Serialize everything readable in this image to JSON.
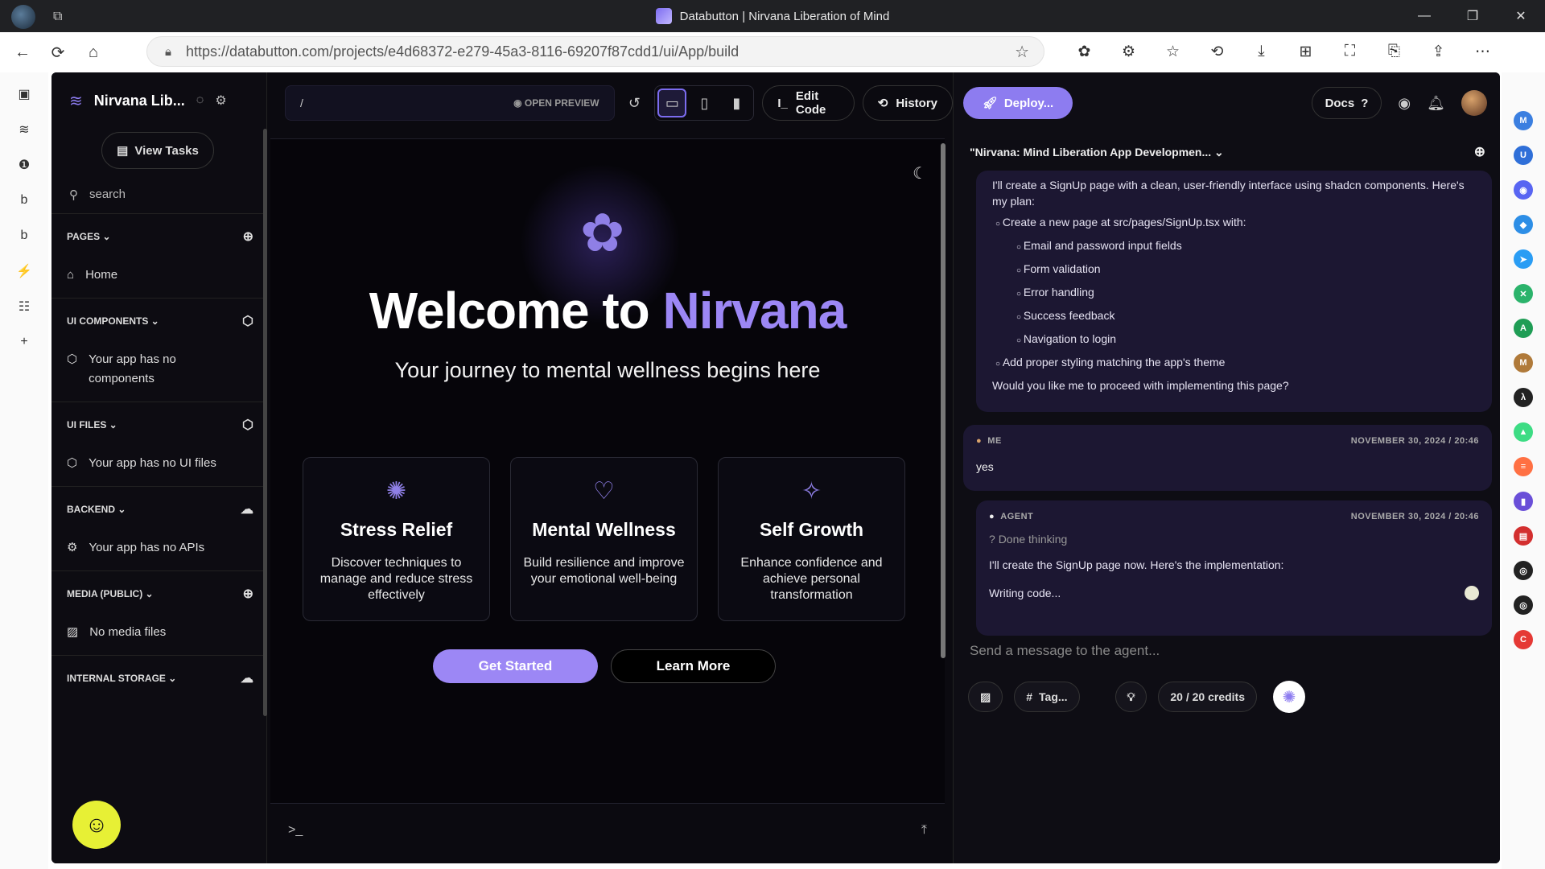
{
  "window": {
    "title": "Databutton | Nirvana Liberation of Mind",
    "min": "—",
    "max": "❐",
    "close": "✕"
  },
  "browser": {
    "url": "https://databutton.com/projects/e4d68372-e279-45a3-8116-69207f87cdd1/ui/App/build",
    "back": "←",
    "reload": "⟳",
    "home": "⌂",
    "ext_icons": [
      "✿",
      "⚙",
      "☆",
      "⟲",
      "⤓",
      "⊞",
      "⛶",
      "⎘",
      "⇪",
      "⋯"
    ],
    "left_icons": [
      "▣",
      "≋",
      "❶",
      "b",
      "b",
      "⚡",
      "☷",
      "+"
    ],
    "right_icons": [
      {
        "t": "M",
        "c": "#3b7fe0"
      },
      {
        "t": "U",
        "c": "#2f6fd8"
      },
      {
        "t": "◉",
        "c": "#5865f2"
      },
      {
        "t": "◆",
        "c": "#2d8ee6"
      },
      {
        "t": "➤",
        "c": "#2a9df4"
      },
      {
        "t": "✕",
        "c": "#2bb36b"
      },
      {
        "t": "A",
        "c": "#1f9d55"
      },
      {
        "t": "M",
        "c": "#b07a3a"
      },
      {
        "t": "λ",
        "c": "#222"
      },
      {
        "t": "▲",
        "c": "#3ddc84"
      },
      {
        "t": "≡",
        "c": "#ff7043"
      },
      {
        "t": "▮",
        "c": "#6a4fd8"
      },
      {
        "t": "▤",
        "c": "#d32f2f"
      },
      {
        "t": "◎",
        "c": "#222"
      },
      {
        "t": "◎",
        "c": "#222"
      },
      {
        "t": "C",
        "c": "#e53935"
      }
    ]
  },
  "sidebar": {
    "project_name": "Nirvana Lib...",
    "view_tasks": "View Tasks",
    "search_placeholder": "search",
    "sections": {
      "pages": {
        "title": "PAGES",
        "item": "Home"
      },
      "ui_components": {
        "title": "UI COMPONENTS",
        "item": "Your app has no components"
      },
      "ui_files": {
        "title": "UI FILES",
        "item": "Your app has no UI files"
      },
      "backend": {
        "title": "BACKEND",
        "item": "Your app has no APIs"
      },
      "media": {
        "title": "MEDIA (PUBLIC)",
        "item": "No media files"
      },
      "storage": {
        "title": "INTERNAL STORAGE"
      }
    }
  },
  "toolbar": {
    "path": "/",
    "open_preview": "OPEN PREVIEW",
    "edit_code": "Edit Code",
    "history": "History"
  },
  "preview": {
    "title_start": "Welcome to ",
    "title_accent": "Nirvana",
    "subtitle": "Your journey to mental wellness begins here",
    "cards": [
      {
        "icon": "brain-icon",
        "glyph": "✺",
        "title": "Stress Relief",
        "text": "Discover techniques to manage and reduce stress effectively"
      },
      {
        "icon": "heart-icon",
        "glyph": "♡",
        "title": "Mental Wellness",
        "text": "Build resilience and improve your emotional well-being"
      },
      {
        "icon": "sparkle-icon",
        "glyph": "✧",
        "title": "Self Growth",
        "text": "Enhance confidence and achieve personal transformation"
      }
    ],
    "get_started": "Get Started",
    "learn_more": "Learn More",
    "console_prompt": ">_"
  },
  "right_panel": {
    "deploy": "Deploy...",
    "docs": "Docs",
    "thread_title": "\"Nirvana: Mind Liberation App Developmen...",
    "agent_msg1": {
      "intro": "I'll create a SignUp page with a clean, user-friendly interface using shadcn components. Here's my plan:",
      "item1": "Create a new page at src/pages/SignUp.tsx with:",
      "sub": [
        "Email and password input fields",
        "Form validation",
        "Error handling",
        "Success feedback",
        "Navigation to login"
      ],
      "item2": "Add proper styling matching the app's theme",
      "question": "Would you like me to proceed with implementing this page?"
    },
    "me_msg": {
      "author": "ME",
      "date": "NOVEMBER 30, 2024 / 20:46",
      "text": "yes"
    },
    "agent_msg2": {
      "author": "AGENT",
      "date": "NOVEMBER 30, 2024 / 20:46",
      "thinking": "Done thinking",
      "text": "I'll create the SignUp page now. Here's the implementation:",
      "status": "Writing code..."
    },
    "composer": {
      "placeholder": "Send a message to the agent...",
      "tag": "Tag...",
      "credits": "20 / 20 credits"
    }
  },
  "colors": {
    "accent": "#9c87f5",
    "deploy": "#8d7cf0",
    "intercom": "#e7f035"
  }
}
